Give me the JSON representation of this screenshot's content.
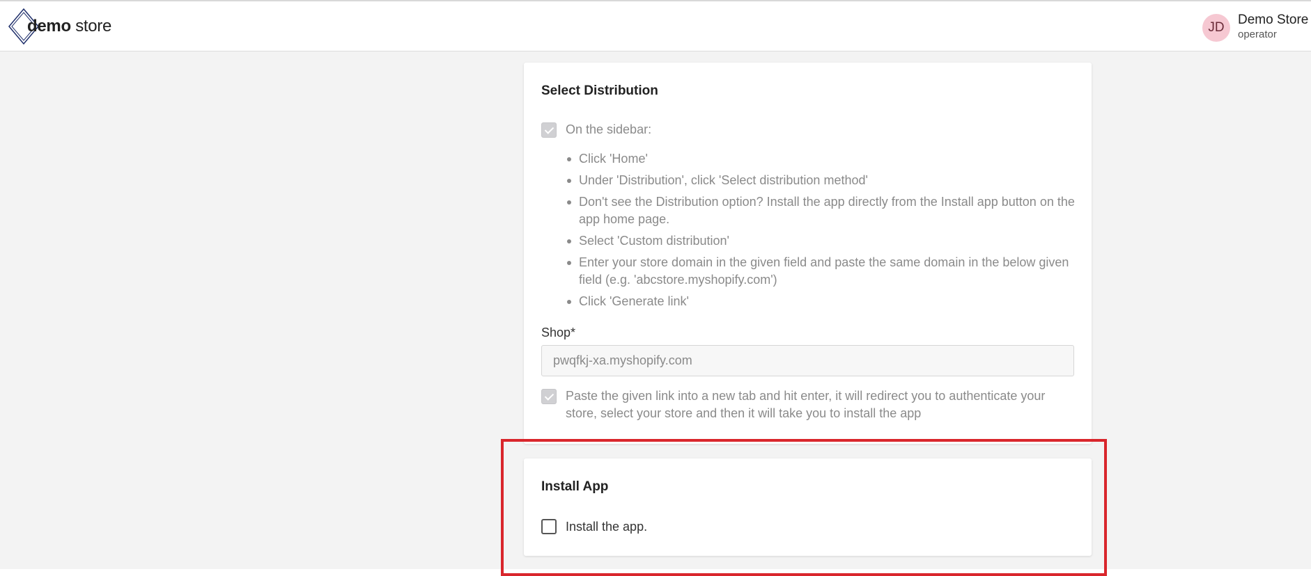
{
  "header": {
    "logo_bold": "demo",
    "logo_light": "store",
    "user_initials": "JD",
    "user_name": "Demo Store",
    "user_role": "operator"
  },
  "distribution": {
    "title": "Select Distribution",
    "step_one": "On the sidebar:",
    "steps": [
      "Click 'Home'",
      "Under 'Distribution', click 'Select distribution method'",
      "Don't see the Distribution option? Install the app directly from the Install app button on the app home page.",
      "Select 'Custom distribution'",
      "Enter your store domain in the given field and paste the same domain in the below given field (e.g. 'abcstore.myshopify.com')",
      "Click 'Generate link'"
    ],
    "shop_label": "Shop*",
    "shop_value": "pwqfkj-xa.myshopify.com",
    "step_two": "Paste the given link into a new tab and hit enter, it will redirect you to authenticate your store, select your store and then it will take you to install the app"
  },
  "install": {
    "title": "Install App",
    "checkbox_label": "Install the app."
  },
  "colors": {
    "highlight": "#d9262c",
    "avatar_bg": "#f6c8d2"
  }
}
